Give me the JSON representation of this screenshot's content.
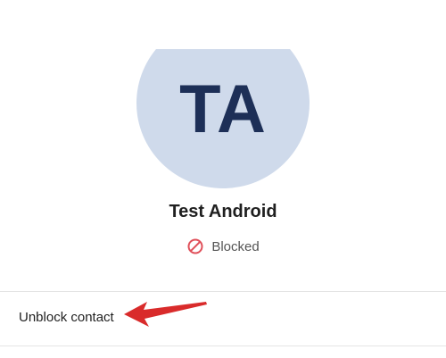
{
  "header": {
    "back_icon": "chevron-left-icon"
  },
  "profile": {
    "initials": "TA",
    "avatar_color": "#cfdaeb",
    "initials_color": "#1d2f57",
    "name": "Test Android"
  },
  "status": {
    "icon": "blocked-icon",
    "icon_color": "#e0505a",
    "label": "Blocked"
  },
  "actions": {
    "unblock_label": "Unblock contact"
  },
  "annotation": {
    "arrow_icon": "red-arrow-icon",
    "color": "#d92b2b"
  }
}
